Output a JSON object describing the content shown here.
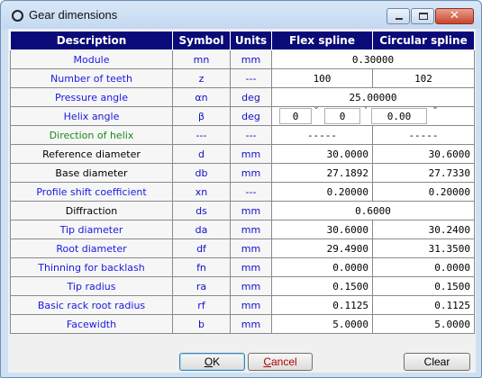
{
  "window": {
    "title": "Gear dimensions",
    "close_glyph": "✕"
  },
  "table": {
    "headers": [
      "Description",
      "Symbol",
      "Units",
      "Flex spline",
      "Circular spline"
    ],
    "rows": [
      {
        "desc": "Module",
        "sym": "mn",
        "unit": "mm",
        "shared": "0.30000"
      },
      {
        "desc": "Number of teeth",
        "sym": "z",
        "unit": "---",
        "flex": "100",
        "circ": "102"
      },
      {
        "desc": "Pressure angle",
        "sym": "αn",
        "unit": "deg",
        "shared": "25.00000"
      },
      {
        "desc": "Helix angle",
        "sym": "β",
        "unit": "deg",
        "helix": {
          "deg": "0",
          "min": "0",
          "sec": "0.00",
          "deg_mark": "°",
          "min_mark": "'",
          "sec_mark": "\""
        }
      },
      {
        "desc": "Direction of helix",
        "sym": "---",
        "unit": "---",
        "flex": "-----",
        "circ": "-----"
      },
      {
        "desc": "Reference diameter",
        "sym": "d",
        "unit": "mm",
        "flex": "30.0000",
        "circ": "30.6000"
      },
      {
        "desc": "Base diameter",
        "sym": "db",
        "unit": "mm",
        "flex": "27.1892",
        "circ": "27.7330"
      },
      {
        "desc": "Profile shift coefficient",
        "sym": "xn",
        "unit": "---",
        "flex": "0.20000",
        "circ": "0.20000"
      },
      {
        "desc": "Diffraction",
        "sym": "ds",
        "unit": "mm",
        "shared": "0.6000"
      },
      {
        "desc": "Tip diameter",
        "sym": "da",
        "unit": "mm",
        "flex": "30.6000",
        "circ": "30.2400"
      },
      {
        "desc": "Root diameter",
        "sym": "df",
        "unit": "mm",
        "flex": "29.4900",
        "circ": "31.3500"
      },
      {
        "desc": "Thinning for backlash",
        "sym": "fn",
        "unit": "mm",
        "flex": "0.0000",
        "circ": "0.0000"
      },
      {
        "desc": "Tip radius",
        "sym": "ra",
        "unit": "mm",
        "flex": "0.1500",
        "circ": "0.1500"
      },
      {
        "desc": "Basic rack root radius",
        "sym": "rf",
        "unit": "mm",
        "flex": "0.1125",
        "circ": "0.1125"
      },
      {
        "desc": "Facewidth",
        "sym": "b",
        "unit": "mm",
        "flex": "5.0000",
        "circ": "5.0000"
      }
    ]
  },
  "buttons": {
    "ok_mnemonic": "O",
    "ok_rest": "K",
    "cancel_mnemonic": "C",
    "cancel_rest": "ancel",
    "clear": "Clear"
  },
  "colors": {
    "header_bg": "#0a0a78",
    "label_blue": "#1a1ae0",
    "label_green": "#1a8a1a"
  }
}
